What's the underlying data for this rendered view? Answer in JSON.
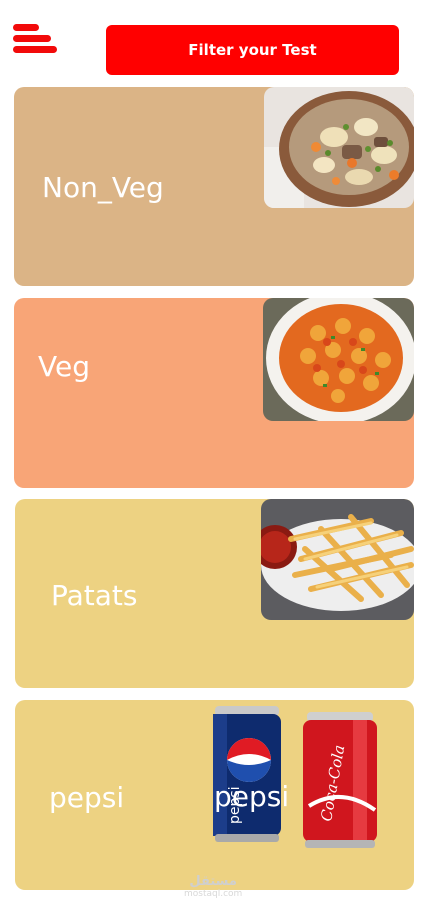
{
  "header": {
    "menu_icon": "hamburger-menu-icon",
    "filter_label": "Filter your Test"
  },
  "cards": [
    {
      "label": "Non_Veg",
      "color": "#dbb486",
      "image": "meat-stew-bowl"
    },
    {
      "label": "Veg",
      "color": "#f8a577",
      "image": "pasta-plate"
    },
    {
      "label": "Patats",
      "color": "#edd282",
      "image": "french-fries-plate"
    },
    {
      "label": "pepsi",
      "color": "#edd282",
      "image": "pepsi-and-coca-cola-cans"
    }
  ],
  "cans": {
    "pepsi_text": "pepsi",
    "overlay_text": "pepsi",
    "coca_cola_text": "Coca-Cola"
  },
  "watermark": {
    "arabic": "مستقل",
    "latin": "mostaql.com"
  },
  "colors": {
    "accent": "#ff0000",
    "white": "#ffffff"
  }
}
